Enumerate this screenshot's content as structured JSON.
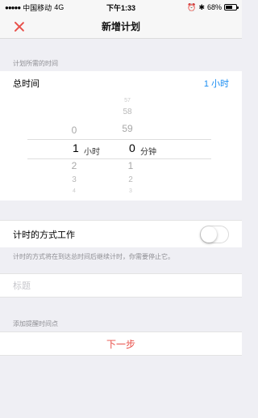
{
  "status_bar": {
    "carrier": "中国移动",
    "network": "4G",
    "time": "下午1:33",
    "battery_percent": "68%",
    "battery_level": 0.68,
    "icons": [
      "signal-dots",
      "alarm-icon",
      "bluetooth-icon",
      "battery-icon"
    ]
  },
  "nav": {
    "title": "新增计划",
    "close_icon": "close-icon",
    "accent_color": "#e8504a"
  },
  "duration_section": {
    "header": "计划所需的时间",
    "total_label": "总时间",
    "total_value": "1 小时",
    "value_color": "#1a8df2"
  },
  "picker": {
    "hours": {
      "above": [
        "0"
      ],
      "selected": "1",
      "unit": "小时",
      "below": [
        "2",
        "3",
        "4"
      ]
    },
    "minutes": {
      "above": [
        "57",
        "58",
        "59"
      ],
      "selected": "0",
      "unit": "分钟",
      "below": [
        "1",
        "2",
        "3"
      ]
    }
  },
  "timer_mode": {
    "label": "计时的方式工作",
    "enabled": false,
    "note": "计时的方式将在到达总时间后继续计时，你需要停止它。"
  },
  "title_field": {
    "placeholder": "标题",
    "value": ""
  },
  "reminder_section": {
    "header": "添加提醒时间点"
  },
  "next_button": {
    "label": "下一步"
  }
}
